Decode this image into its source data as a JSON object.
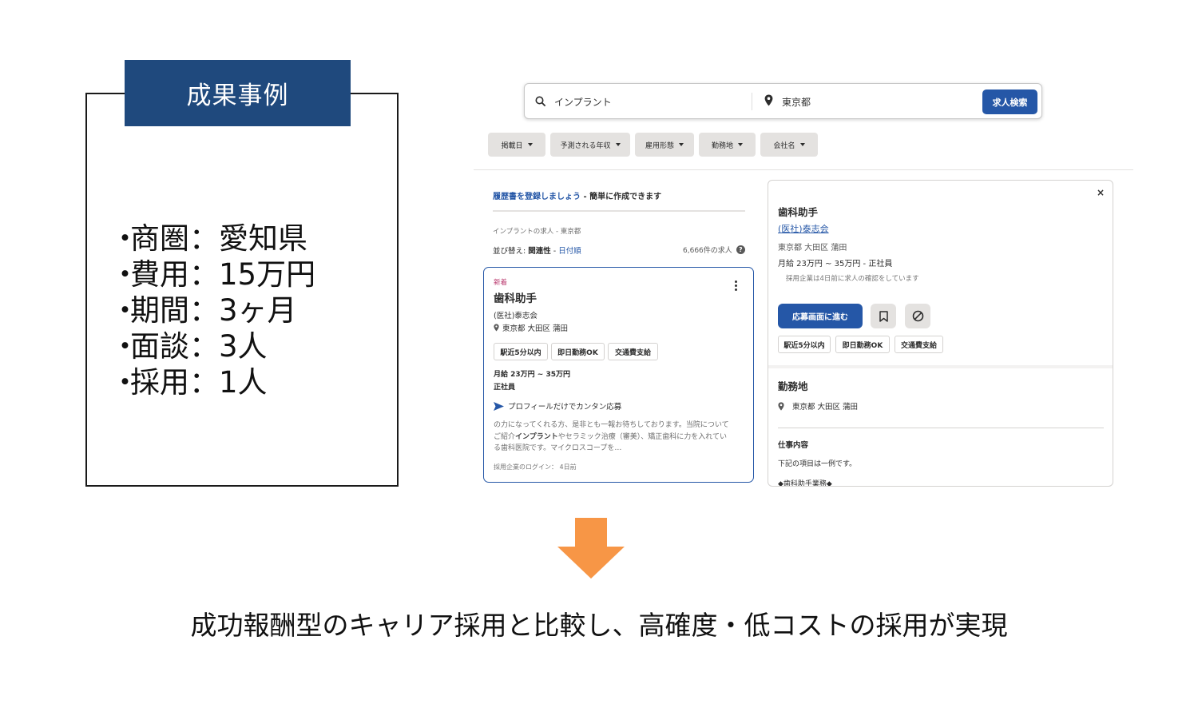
{
  "case": {
    "title": "成果事例",
    "items": [
      "商圏：愛知県",
      "費用：15万円",
      "期間：3ヶ月",
      "面談：3人",
      "採用：1人"
    ]
  },
  "search": {
    "keyword": "インプラント",
    "location": "東京都",
    "button_label": "求人検索",
    "search_icon": "search-icon",
    "location_icon": "location-pin-icon"
  },
  "filters": [
    "掲載日",
    "予測される年収",
    "雇用形態",
    "勤務地",
    "会社名"
  ],
  "results": {
    "resume_link": "履歴書を登録しましょう",
    "resume_suffix": " - 簡単に作成できます",
    "breadcrumb": "インプラントの求人 - 東京都",
    "sort_prefix": "並び替え: ",
    "sort_active": "関連性",
    "sort_sep": " - ",
    "sort_alt": "日付順",
    "count": "6,666件の求人"
  },
  "job_card": {
    "badge": "新着",
    "title": "歯科助手",
    "company": "(医社)泰志会",
    "location": "東京都 大田区 蒲田",
    "tags": [
      "駅近5分以内",
      "即日勤務OK",
      "交通費支給"
    ],
    "salary": "月給 23万円 ~ 35万円",
    "employment_type": "正社員",
    "apply_text": "プロフィールだけでカンタン応募",
    "snippet_1": "の力になってくれる方、是非とも一報お待ちしております。当院についてご紹介",
    "snippet_bold": "インプラント",
    "snippet_2": "やセラミック治療（審美）、矯正歯科に力を入れている歯科医院です。マイクロスコープを…",
    "login": "採用企業のログイン： 4日前"
  },
  "detail": {
    "close": "×",
    "title": "歯科助手",
    "company": "(医社)泰志会",
    "location": "東京都 大田区 蒲田",
    "salary": "月給 23万円 ~ 35万円  - 正社員",
    "note": "採用企業は4日前に求人の確認をしています",
    "apply_label": "応募画面に進む",
    "save_icon": "bookmark-icon",
    "hide_icon": "not-interested-icon",
    "tags": [
      "駅近5分以内",
      "即日勤務OK",
      "交通費支給"
    ],
    "section_location_title": "勤務地",
    "section_location_value": "東京都 大田区 蒲田",
    "section_job_title": "仕事内容",
    "section_job_p1": "下記の項目は一例です。",
    "section_job_p2": "◆歯科助手業務◆"
  },
  "conclusion": "成功報酬型のキャリア採用と比較し、高確度・低コストの採用が実現",
  "colors": {
    "title_bg": "#1f497d",
    "primary_blue": "#2557a7",
    "arrow": "#f79646",
    "new_badge": "#b8356b"
  }
}
